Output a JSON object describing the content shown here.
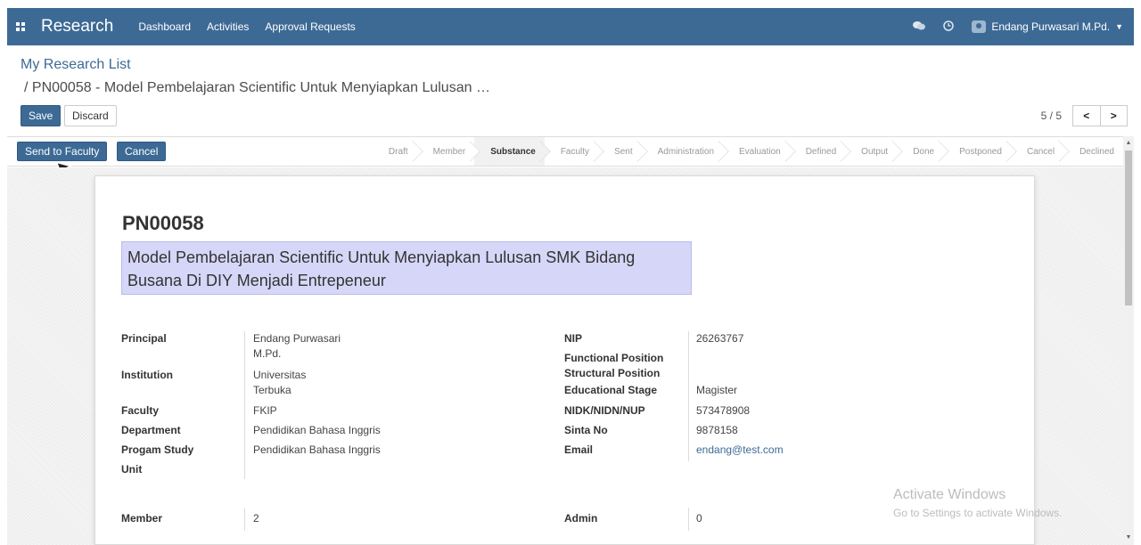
{
  "topbar": {
    "brand": "Research",
    "menu": [
      "Dashboard",
      "Activities",
      "Approval Requests"
    ],
    "user": "Endang Purwasari M.Pd."
  },
  "breadcrumb": {
    "parent": "My Research List",
    "current": "/ PN00058 - Model Pembelajaran Scientific Untuk Menyiapkan Lulusan …"
  },
  "actions": {
    "save": "Save",
    "discard": "Discard"
  },
  "pager": {
    "text": "5 / 5",
    "prev": "<",
    "next": ">"
  },
  "workflow_buttons": {
    "send_faculty": "Send to Faculty",
    "cancel": "Cancel"
  },
  "stages": [
    {
      "label": "Draft",
      "active": false
    },
    {
      "label": "Member",
      "active": false
    },
    {
      "label": "Substance",
      "active": true
    },
    {
      "label": "Faculty",
      "active": false
    },
    {
      "label": "Sent",
      "active": false
    },
    {
      "label": "Administration",
      "active": false
    },
    {
      "label": "Evaluation",
      "active": false
    },
    {
      "label": "Defined",
      "active": false
    },
    {
      "label": "Output",
      "active": false
    },
    {
      "label": "Done",
      "active": false
    },
    {
      "label": "Postponed",
      "active": false
    },
    {
      "label": "Cancel",
      "active": false
    },
    {
      "label": "Declined",
      "active": false
    }
  ],
  "record": {
    "code": "PN00058",
    "title_line1": "Model Pembelajaran Scientific Untuk Menyiapkan Lulusan SMK Bidang",
    "title_line2": "Busana Di DIY Menjadi Entrepeneur"
  },
  "left_fields": {
    "principal_label": "Principal",
    "principal_value_1": "Endang Purwasari",
    "principal_value_2": "M.Pd.",
    "institution_label": "Institution",
    "institution_value_1": "Universitas",
    "institution_value_2": "Terbuka",
    "faculty_label": "Faculty",
    "faculty_value": "FKIP",
    "department_label": "Department",
    "department_value": "Pendidikan Bahasa Inggris",
    "program_label": "Progam Study",
    "program_value": "Pendidikan Bahasa Inggris",
    "unit_label": "Unit",
    "member_label": "Member",
    "member_value": "2"
  },
  "right_fields": {
    "nip_label": "NIP",
    "nip_value": "26263767",
    "functional_label": "Functional Position",
    "structural_label": "Structural Position",
    "educational_label": "Educational Stage",
    "educational_value": "Magister",
    "nidk_label": "NIDK/NIDN/NUP",
    "nidk_value": "573478908",
    "sinta_label": "Sinta No",
    "sinta_value": "9878158",
    "email_label": "Email",
    "email_value": "endang@test.com",
    "admin_label": "Admin",
    "admin_value": "0"
  },
  "watermark": {
    "line1": "Activate Windows",
    "line2": "Go to Settings to activate Windows."
  },
  "colors": {
    "brand": "#3d6a95",
    "title_field_bg": "#d6d7f8"
  },
  "icons": [
    "apps-icon",
    "chat-icon",
    "clock-icon",
    "avatar-icon",
    "caret-down-icon",
    "chevron-left-icon",
    "chevron-right-icon",
    "cursor-arrow-icon"
  ]
}
